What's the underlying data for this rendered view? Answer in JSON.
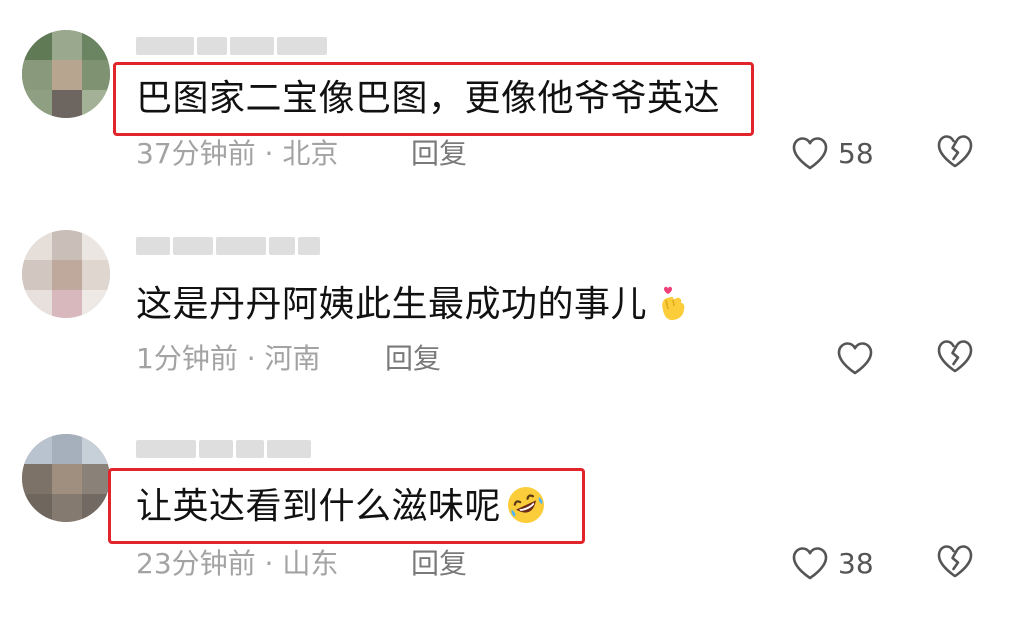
{
  "comments": [
    {
      "text": "巴图家二宝像巴图，更像他爷爷英达",
      "time": "37分钟前",
      "separator": "·",
      "location": "北京",
      "reply_label": "回复",
      "likes": "58",
      "highlighted": true,
      "emoji": ""
    },
    {
      "text": "这是丹丹阿姨此生最成功的事儿",
      "time": "1分钟前",
      "separator": "·",
      "location": "河南",
      "reply_label": "回复",
      "likes": "",
      "highlighted": false,
      "emoji": "finger-heart-emoji"
    },
    {
      "text": "让英达看到什么滋味呢",
      "time": "23分钟前",
      "separator": "·",
      "location": "山东",
      "reply_label": "回复",
      "likes": "38",
      "highlighted": true,
      "emoji": "rolling-laughing-emoji"
    }
  ],
  "colors": {
    "highlight_border": "#e1252b",
    "meta_text": "#a3a3a3",
    "comment_text": "#111111",
    "icon_stroke": "#555555"
  }
}
